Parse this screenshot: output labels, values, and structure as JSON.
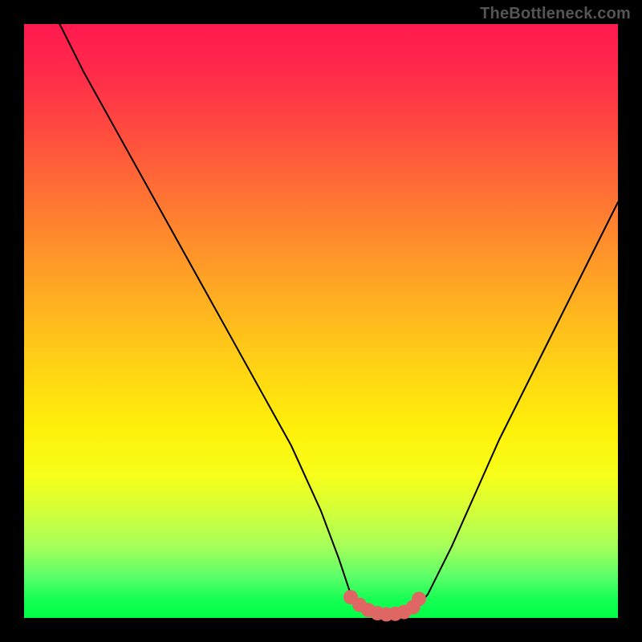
{
  "watermark": "TheBottleneck.com",
  "colors": {
    "curve": "#000000",
    "marker_fill": "#de6763",
    "marker_stroke": "#de6763",
    "background_top": "#ff1a4f",
    "background_bottom": "#00ff45"
  },
  "chart_data": {
    "type": "line",
    "title": "",
    "xlabel": "",
    "ylabel": "",
    "xlim": [
      0,
      100
    ],
    "ylim": [
      0,
      100
    ],
    "note": "V-shaped bottleneck curve; y≈100 is worst (red), y≈0 is best (green). Minimum plateau around x≈55–66.",
    "series": [
      {
        "name": "bottleneck-curve",
        "x": [
          6,
          10,
          15,
          20,
          25,
          30,
          35,
          40,
          45,
          50,
          53,
          55,
          58,
          60,
          62,
          64,
          66,
          68,
          72,
          76,
          80,
          85,
          90,
          95,
          100
        ],
        "y": [
          100,
          92,
          83,
          74,
          65,
          56,
          47,
          38,
          29,
          18,
          10,
          4,
          1,
          0.5,
          0.5,
          0.7,
          1.5,
          4,
          12,
          21,
          30,
          40,
          50,
          60,
          70
        ]
      }
    ],
    "markers": {
      "name": "optimal-zone",
      "x": [
        55,
        56.5,
        58,
        59.5,
        61,
        62.5,
        64,
        65.5,
        66.5
      ],
      "y": [
        3.5,
        2.2,
        1.3,
        0.8,
        0.6,
        0.7,
        1.0,
        1.8,
        3.2
      ]
    }
  }
}
